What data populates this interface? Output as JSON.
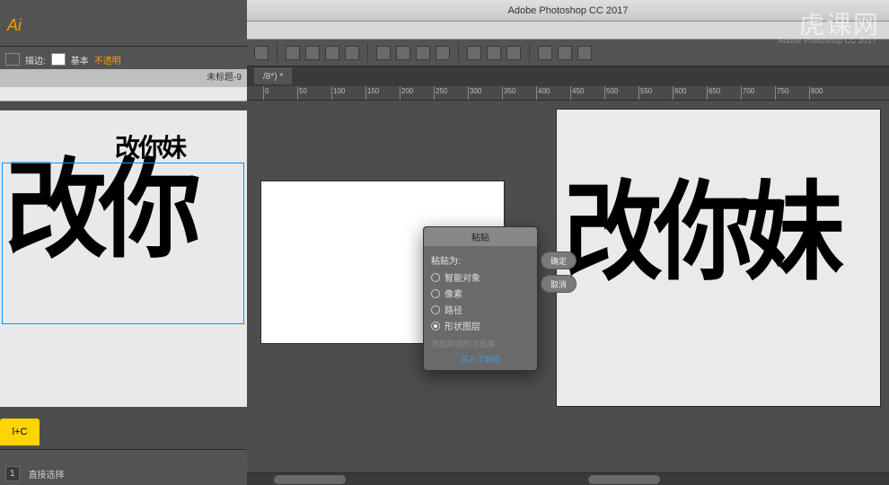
{
  "illustrator": {
    "logo": "Ai",
    "stroke_label": "描边:",
    "basic_label": "基本",
    "opacity_label": "不透明",
    "doc_tab": "未标题-9",
    "shortcut_note": "l+C",
    "zoom": "1",
    "status_tool": "直接选择",
    "artboard_small_text": "改你妹",
    "artboard_big_text": "改你"
  },
  "photoshop": {
    "app_title": "Adobe Photoshop CC 2017",
    "menubar": [],
    "doc_tab": "/8*) *",
    "ruler_ticks": [
      0,
      50,
      100,
      150,
      200,
      250,
      300,
      350,
      400,
      450,
      500,
      550,
      600,
      650,
      700,
      750,
      800
    ],
    "right_doc_text": "改你妹",
    "second_title": "Adobe Photoshop CC 2017"
  },
  "paste_dialog": {
    "title": "粘贴",
    "paste_as_label": "粘贴为:",
    "opts": {
      "smart_object": "智能对象",
      "pixels": "像素",
      "path": "路径",
      "shape_layer": "形状图层"
    },
    "selected": "shape_layer",
    "ok": "确定",
    "cancel": "取消",
    "add_to_lib": "添加到我的当前库",
    "learn_more": "深入了解库"
  },
  "watermark": {
    "main": "虎课网",
    "sub": "Adobe Photoshop CC 2017"
  }
}
